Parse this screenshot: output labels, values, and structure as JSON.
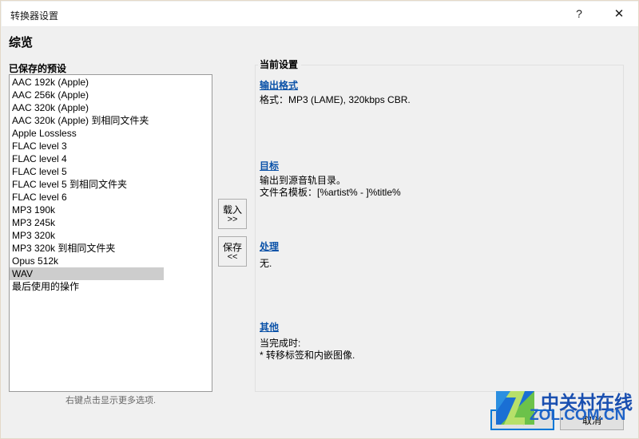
{
  "window": {
    "title": "转换器设置",
    "help_label": "?",
    "close_label": "✕"
  },
  "page": {
    "heading": "综览"
  },
  "presets": {
    "label": "已保存的预设",
    "hint": "右键点击显示更多选项.",
    "selected_index": 15,
    "items": [
      "AAC 192k (Apple)",
      "AAC 256k (Apple)",
      "AAC 320k (Apple)",
      "AAC 320k (Apple) 到相同文件夹",
      "Apple Lossless",
      "FLAC level 3",
      "FLAC level 4",
      "FLAC level 5",
      "FLAC level 5 到相同文件夹",
      "FLAC level 6",
      "MP3 190k",
      "MP3 245k",
      "MP3 320k",
      "MP3 320k 到相同文件夹",
      "Opus 512k",
      "WAV",
      "最后使用的操作"
    ]
  },
  "transfer_buttons": {
    "load_line1": "载入",
    "load_line2": ">>",
    "save_line1": "保存",
    "save_line2": "<<"
  },
  "current_settings": {
    "title": "当前设置",
    "sections": [
      {
        "link": "输出格式",
        "body": "格式：MP3 (LAME), 320kbps CBR."
      },
      {
        "link": "目标",
        "body": "输出到源音轨目录。\n文件名模板：[%artist% - ]%title%"
      },
      {
        "link": "处理",
        "body": "无."
      },
      {
        "link": "其他",
        "body": "当完成时:\n* 转移标签和内嵌图像."
      }
    ]
  },
  "footer": {
    "ok_label": "确定",
    "cancel_label": "取消"
  },
  "watermark": {
    "cn_text": "中关村在线",
    "url_text": "ZOL.COM.CN"
  },
  "colors": {
    "link": "#0b52a8",
    "accent": "#0078d7",
    "selection": "#cdcdcd",
    "dialog_bg": "#f0f0f0"
  }
}
